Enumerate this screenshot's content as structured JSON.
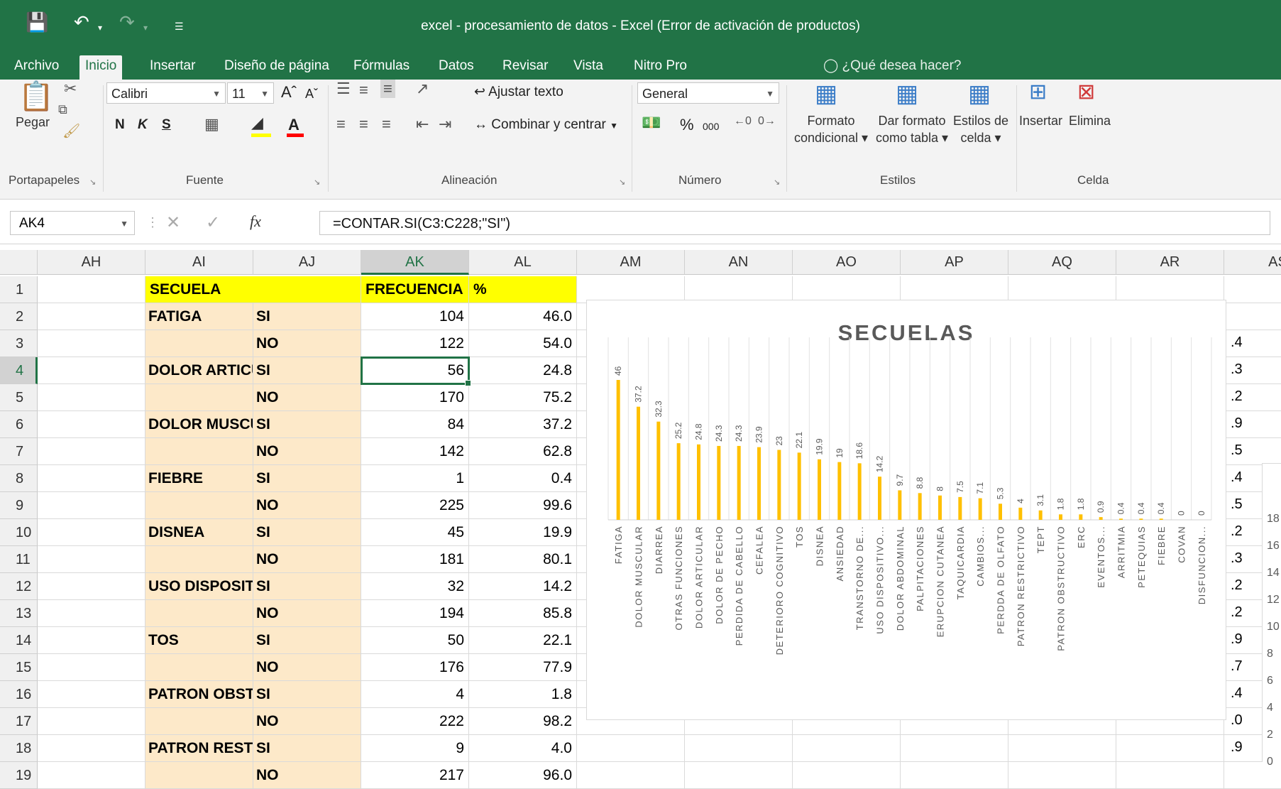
{
  "window": {
    "title": "excel - procesamiento de datos - Excel (Error de activación de productos)"
  },
  "tabs": [
    "Archivo",
    "Inicio",
    "Insertar",
    "Diseño de página",
    "Fórmulas",
    "Datos",
    "Revisar",
    "Vista",
    "Nitro Pro"
  ],
  "tellme": "¿Qué desea hacer?",
  "ribbon": {
    "clipboard": {
      "paste": "Pegar",
      "label": "Portapapeles"
    },
    "font": {
      "name": "Calibri",
      "size": "11",
      "bold": "N",
      "italic": "K",
      "underline": "S",
      "label": "Fuente"
    },
    "alignment": {
      "wrap": "Ajustar texto",
      "merge": "Combinar y centrar",
      "label": "Alineación"
    },
    "number": {
      "format": "General",
      "percent": "%",
      "thousands": "000",
      "label": "Número"
    },
    "styles": {
      "conditional": [
        "Formato",
        "condicional"
      ],
      "table": [
        "Dar formato",
        "como tabla"
      ],
      "cell": [
        "Estilos de",
        "celda"
      ],
      "label": "Estilos"
    },
    "cells": {
      "insert": "Insertar",
      "delete": "Elimina",
      "label": "Celda"
    }
  },
  "formula_bar": {
    "namebox": "AK4",
    "formula": "=CONTAR.SI(C3:C228;\"SI\")",
    "fx": "fx"
  },
  "columns": [
    "AH",
    "AI",
    "AJ",
    "AK",
    "AL",
    "AM",
    "AN",
    "AO",
    "AP",
    "AQ",
    "AR",
    "AS"
  ],
  "rows": [
    "1",
    "2",
    "3",
    "4",
    "5",
    "6",
    "7",
    "8",
    "9",
    "10",
    "11",
    "12",
    "13",
    "14",
    "15",
    "16",
    "17",
    "18",
    "19"
  ],
  "headers": {
    "secuela": "SECUELA",
    "frecuencia": "FRECUENCIA",
    "pct": "%"
  },
  "table": [
    {
      "ai": "FATIGA",
      "aj": "SI",
      "ak": "104",
      "al": "46.0"
    },
    {
      "ai": "",
      "aj": "NO",
      "ak": "122",
      "al": "54.0"
    },
    {
      "ai": "DOLOR ARTICULAR",
      "aj": "SI",
      "ak": "56",
      "al": "24.8"
    },
    {
      "ai": "",
      "aj": "NO",
      "ak": "170",
      "al": "75.2"
    },
    {
      "ai": "DOLOR MUSCULAR",
      "aj": "SI",
      "ak": "84",
      "al": "37.2"
    },
    {
      "ai": "",
      "aj": "NO",
      "ak": "142",
      "al": "62.8"
    },
    {
      "ai": "FIEBRE",
      "aj": "SI",
      "ak": "1",
      "al": "0.4"
    },
    {
      "ai": "",
      "aj": "NO",
      "ak": "225",
      "al": "99.6"
    },
    {
      "ai": "DISNEA",
      "aj": "SI",
      "ak": "45",
      "al": "19.9"
    },
    {
      "ai": "",
      "aj": "NO",
      "ak": "181",
      "al": "80.1"
    },
    {
      "ai": "USO DISPOSITIVO",
      "aj": "SI",
      "ak": "32",
      "al": "14.2"
    },
    {
      "ai": "",
      "aj": "NO",
      "ak": "194",
      "al": "85.8"
    },
    {
      "ai": "TOS",
      "aj": "SI",
      "ak": "50",
      "al": "22.1"
    },
    {
      "ai": "",
      "aj": "NO",
      "ak": "176",
      "al": "77.9"
    },
    {
      "ai": "PATRON OBSTRUCTIVO",
      "aj": "SI",
      "ak": "4",
      "al": "1.8"
    },
    {
      "ai": "",
      "aj": "NO",
      "ak": "222",
      "al": "98.2"
    },
    {
      "ai": "PATRON RESTRICTIVO",
      "aj": "SI",
      "ak": "9",
      "al": "4.0"
    },
    {
      "ai": "",
      "aj": "NO",
      "ak": "217",
      "al": "96.0"
    }
  ],
  "edge_values": [
    ".4",
    ".3",
    ".2",
    ".9",
    ".5",
    ".4",
    ".5",
    ".2",
    ".3",
    ".2",
    ".2",
    ".9",
    ".7",
    ".4",
    ".0",
    ".9"
  ],
  "edge_axis": [
    "18",
    "16",
    "14",
    "12",
    "10",
    "8",
    "6",
    "4",
    "2",
    "0"
  ],
  "chart_data": {
    "type": "bar",
    "title": "SECUELAS",
    "bar_color": "#ffc000",
    "categories": [
      "FATIGA",
      "DOLOR MUSCULAR",
      "DIARREA",
      "OTRAS FUNCIONES",
      "DOLOR ARTICULAR",
      "DOLOR DE PECHO",
      "PERDIDA DE CABELLO",
      "CEFALEA",
      "DETERIORO COGNITIVO",
      "TOS",
      "DISNEA",
      "ANSIEDAD",
      "TRANSTORNO DE...",
      "USO DISPOSITIVO...",
      "DOLOR ABDOMINAL",
      "PALPITACIONES",
      "ERUPCION CUTANEA",
      "TAQUICARDIA",
      "CAMBIOS...",
      "PERDDA DE OLFATO",
      "PATRON RESTRICTIVO",
      "TEPT",
      "PATRON OBSTRUCTIVO",
      "ERC",
      "EVENTOS...",
      "ARRITMIA",
      "PETEQUIAS",
      "FIEBRE",
      "COVAN",
      "DISFUNCION..."
    ],
    "values": [
      46,
      37.2,
      32.3,
      25.2,
      24.8,
      24.3,
      24.3,
      23.9,
      23,
      22.1,
      19.9,
      19,
      18.6,
      14.2,
      9.7,
      8.8,
      8,
      7.5,
      7.1,
      5.3,
      4,
      3.1,
      1.8,
      1.8,
      0.9,
      0.4,
      0.4,
      0.4,
      0,
      0
    ],
    "labels": [
      "46",
      "37.2",
      "32.3",
      "25.2",
      "24.8",
      "24.3",
      "24.3",
      "23.9",
      "23",
      "22.1",
      "19.9",
      "19",
      "18.6",
      "14.2",
      "9.7",
      "8.8",
      "8",
      "7.5",
      "7.1",
      "5.3",
      "4",
      "3.1",
      "1.8",
      "1.8",
      "0.9",
      "0.4",
      "0.4",
      "0.4",
      "0",
      "0"
    ],
    "ylim": [
      0,
      50
    ],
    "grid": "vertical",
    "legend": "none"
  }
}
